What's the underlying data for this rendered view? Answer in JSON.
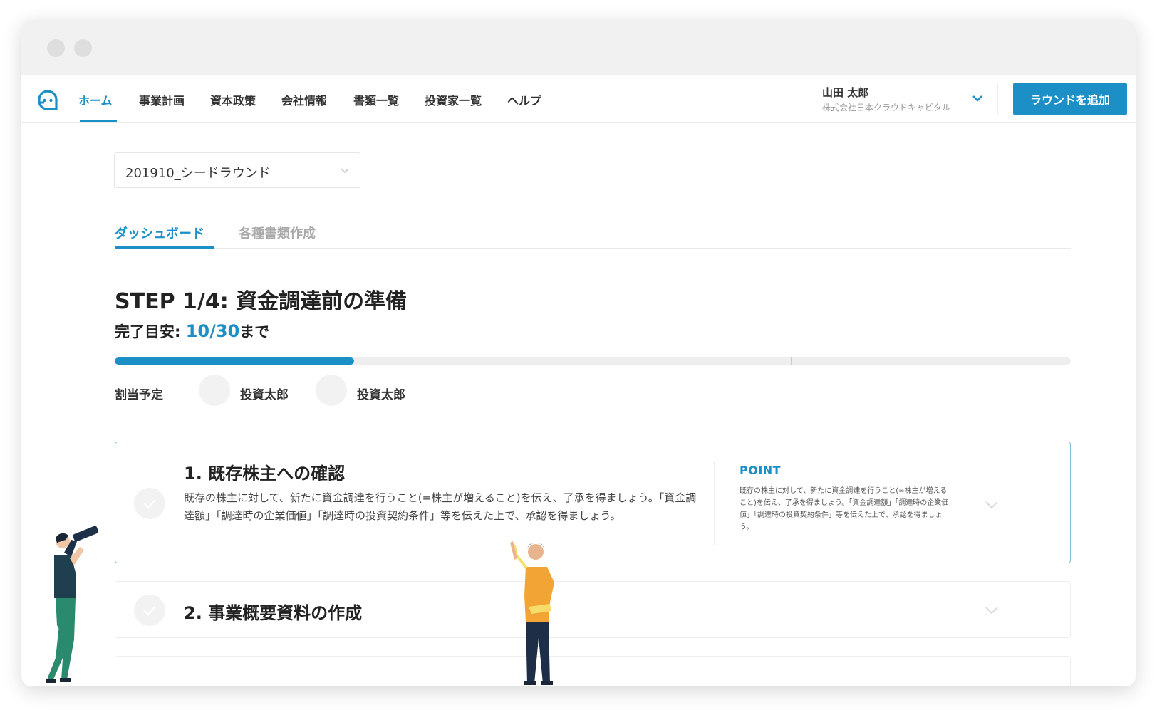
{
  "nav": {
    "items": [
      "ホーム",
      "事業計画",
      "資本政策",
      "会社情報",
      "書類一覧",
      "投資家一覧",
      "ヘルプ"
    ],
    "active_index": 0
  },
  "user": {
    "name": "山田 太郎",
    "company": "株式会社日本クラウドキャピタル"
  },
  "actions": {
    "add_round": "ラウンドを追加"
  },
  "round_select": {
    "value": "201910_シードラウンド"
  },
  "tabs": [
    "ダッシュボード",
    "各種書類作成"
  ],
  "step": {
    "title": "STEP 1/4: 資金調達前の準備",
    "deadline_label": "完了目安: ",
    "deadline_date": "10/30",
    "deadline_suffix": "まで",
    "progress_fraction": 0.25
  },
  "allocation": {
    "label": "割当予定",
    "investors": [
      "投資太郎",
      "投資太郎"
    ]
  },
  "tasks": [
    {
      "title": "1. 既存株主への確認",
      "description": "既存の株主に対して、新たに資金調達を行うこと(=株主が増えること)を伝え、了承を得ましょう。「資金調達額」「調達時の企業価値」「調達時の投資契約条件」等を伝えた上で、承認を得ましょう。",
      "point_label": "POINT",
      "point_text": "既存の株主に対して、新たに資金調達を行うこと(=株主が増えること)を伝え、了承を得ましょう。「資金調達額」「調達時の企業価値」「調達時の投資契約条件」等を伝えた上で、承認を得ましょう。"
    },
    {
      "title": "2. 事業概要資料の作成"
    }
  ],
  "colors": {
    "accent": "#1b8fc6"
  },
  "icons": {
    "logo": "logo-icon",
    "chevron": "chevron-down-icon",
    "check": "check-icon"
  }
}
